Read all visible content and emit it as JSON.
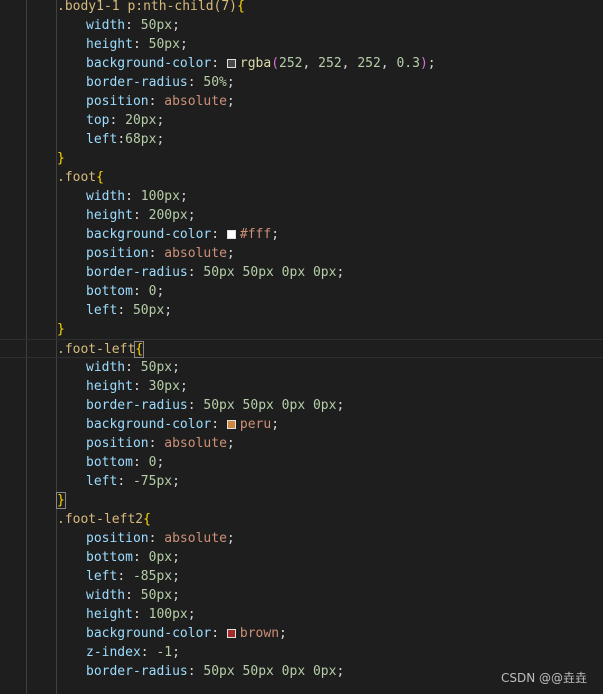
{
  "colors": {
    "background": "#1e1e1e",
    "selector": "#d7ba7d",
    "brace": "#ffd700",
    "property": "#9cdcfe",
    "number": "#b5cea8",
    "keyword": "#ce9178",
    "function": "#dcdcaa",
    "paren": "#da70d6"
  },
  "lines": [
    {
      "indent": 1,
      "tokens": [
        {
          "t": ".body1-1 p:nth-child(7)",
          "c": "sel"
        },
        {
          "t": "{",
          "c": "brace"
        }
      ]
    },
    {
      "indent": 2,
      "tokens": [
        {
          "t": "width",
          "c": "prop"
        },
        {
          "t": ": ",
          "c": "punct"
        },
        {
          "t": "50px",
          "c": "num"
        },
        {
          "t": ";",
          "c": "punct"
        }
      ]
    },
    {
      "indent": 2,
      "tokens": [
        {
          "t": "height",
          "c": "prop"
        },
        {
          "t": ": ",
          "c": "punct"
        },
        {
          "t": "50px",
          "c": "num"
        },
        {
          "t": ";",
          "c": "punct"
        }
      ]
    },
    {
      "indent": 2,
      "tokens": [
        {
          "t": "background-color",
          "c": "prop"
        },
        {
          "t": ": ",
          "c": "punct"
        },
        {
          "swatch": "#4a4a4a"
        },
        {
          "t": "rgba",
          "c": "fn"
        },
        {
          "t": "(",
          "c": "paren"
        },
        {
          "t": "252",
          "c": "num"
        },
        {
          "t": ", ",
          "c": "punct"
        },
        {
          "t": "252",
          "c": "num"
        },
        {
          "t": ", ",
          "c": "punct"
        },
        {
          "t": "252",
          "c": "num"
        },
        {
          "t": ", ",
          "c": "punct"
        },
        {
          "t": "0.3",
          "c": "num"
        },
        {
          "t": ")",
          "c": "paren"
        },
        {
          "t": ";",
          "c": "punct"
        }
      ]
    },
    {
      "indent": 2,
      "tokens": [
        {
          "t": "border-radius",
          "c": "prop"
        },
        {
          "t": ": ",
          "c": "punct"
        },
        {
          "t": "50%",
          "c": "num"
        },
        {
          "t": ";",
          "c": "punct"
        }
      ]
    },
    {
      "indent": 2,
      "tokens": [
        {
          "t": "position",
          "c": "prop"
        },
        {
          "t": ": ",
          "c": "punct"
        },
        {
          "t": "absolute",
          "c": "kw"
        },
        {
          "t": ";",
          "c": "punct"
        }
      ]
    },
    {
      "indent": 2,
      "tokens": [
        {
          "t": "top",
          "c": "prop"
        },
        {
          "t": ": ",
          "c": "punct"
        },
        {
          "t": "20px",
          "c": "num"
        },
        {
          "t": ";",
          "c": "punct"
        }
      ]
    },
    {
      "indent": 2,
      "tokens": [
        {
          "t": "left",
          "c": "prop"
        },
        {
          "t": ":",
          "c": "punct"
        },
        {
          "t": "68px",
          "c": "num"
        },
        {
          "t": ";",
          "c": "punct"
        }
      ]
    },
    {
      "indent": 1,
      "tokens": [
        {
          "t": "}",
          "c": "brace"
        }
      ]
    },
    {
      "indent": 1,
      "tokens": [
        {
          "t": ".foot",
          "c": "sel"
        },
        {
          "t": "{",
          "c": "brace"
        }
      ]
    },
    {
      "indent": 2,
      "tokens": [
        {
          "t": "width",
          "c": "prop"
        },
        {
          "t": ": ",
          "c": "punct"
        },
        {
          "t": "100px",
          "c": "num"
        },
        {
          "t": ";",
          "c": "punct"
        }
      ]
    },
    {
      "indent": 2,
      "tokens": [
        {
          "t": "height",
          "c": "prop"
        },
        {
          "t": ": ",
          "c": "punct"
        },
        {
          "t": "200px",
          "c": "num"
        },
        {
          "t": ";",
          "c": "punct"
        }
      ]
    },
    {
      "indent": 2,
      "tokens": [
        {
          "t": "background-color",
          "c": "prop"
        },
        {
          "t": ": ",
          "c": "punct"
        },
        {
          "swatch": "#ffffff"
        },
        {
          "t": "#fff",
          "c": "kw"
        },
        {
          "t": ";",
          "c": "punct"
        }
      ]
    },
    {
      "indent": 2,
      "tokens": [
        {
          "t": "position",
          "c": "prop"
        },
        {
          "t": ": ",
          "c": "punct"
        },
        {
          "t": "absolute",
          "c": "kw"
        },
        {
          "t": ";",
          "c": "punct"
        }
      ]
    },
    {
      "indent": 2,
      "tokens": [
        {
          "t": "border-radius",
          "c": "prop"
        },
        {
          "t": ": ",
          "c": "punct"
        },
        {
          "t": "50px 50px 0px 0px",
          "c": "num"
        },
        {
          "t": ";",
          "c": "punct"
        }
      ]
    },
    {
      "indent": 2,
      "tokens": [
        {
          "t": "bottom",
          "c": "prop"
        },
        {
          "t": ": ",
          "c": "punct"
        },
        {
          "t": "0",
          "c": "num"
        },
        {
          "t": ";",
          "c": "punct"
        }
      ]
    },
    {
      "indent": 2,
      "tokens": [
        {
          "t": "left",
          "c": "prop"
        },
        {
          "t": ": ",
          "c": "punct"
        },
        {
          "t": "50px",
          "c": "num"
        },
        {
          "t": ";",
          "c": "punct"
        }
      ]
    },
    {
      "indent": 1,
      "tokens": [
        {
          "t": "}",
          "c": "brace"
        }
      ]
    },
    {
      "indent": 1,
      "current": true,
      "tokens": [
        {
          "t": ".foot-left",
          "c": "sel"
        },
        {
          "t": "{",
          "c": "brace active"
        }
      ]
    },
    {
      "indent": 2,
      "tokens": [
        {
          "t": "width",
          "c": "prop"
        },
        {
          "t": ": ",
          "c": "punct"
        },
        {
          "t": "50px",
          "c": "num"
        },
        {
          "t": ";",
          "c": "punct"
        }
      ]
    },
    {
      "indent": 2,
      "tokens": [
        {
          "t": "height",
          "c": "prop"
        },
        {
          "t": ": ",
          "c": "punct"
        },
        {
          "t": "30px",
          "c": "num"
        },
        {
          "t": ";",
          "c": "punct"
        }
      ]
    },
    {
      "indent": 2,
      "tokens": [
        {
          "t": "border-radius",
          "c": "prop"
        },
        {
          "t": ": ",
          "c": "punct"
        },
        {
          "t": "50px 50px 0px 0px",
          "c": "num"
        },
        {
          "t": ";",
          "c": "punct"
        }
      ]
    },
    {
      "indent": 2,
      "tokens": [
        {
          "t": "background-color",
          "c": "prop"
        },
        {
          "t": ": ",
          "c": "punct"
        },
        {
          "swatch": "#cd853f"
        },
        {
          "t": "peru",
          "c": "kw"
        },
        {
          "t": ";",
          "c": "punct"
        }
      ]
    },
    {
      "indent": 2,
      "tokens": [
        {
          "t": "position",
          "c": "prop"
        },
        {
          "t": ": ",
          "c": "punct"
        },
        {
          "t": "absolute",
          "c": "kw"
        },
        {
          "t": ";",
          "c": "punct"
        }
      ]
    },
    {
      "indent": 2,
      "tokens": [
        {
          "t": "bottom",
          "c": "prop"
        },
        {
          "t": ": ",
          "c": "punct"
        },
        {
          "t": "0",
          "c": "num"
        },
        {
          "t": ";",
          "c": "punct"
        }
      ]
    },
    {
      "indent": 2,
      "tokens": [
        {
          "t": "left",
          "c": "prop"
        },
        {
          "t": ": ",
          "c": "punct"
        },
        {
          "t": "-75px",
          "c": "num"
        },
        {
          "t": ";",
          "c": "punct"
        }
      ]
    },
    {
      "indent": 1,
      "tokens": [
        {
          "t": "}",
          "c": "brace active"
        }
      ]
    },
    {
      "indent": 1,
      "tokens": [
        {
          "t": ".foot-left2",
          "c": "sel"
        },
        {
          "t": "{",
          "c": "brace"
        }
      ]
    },
    {
      "indent": 2,
      "tokens": [
        {
          "t": "position",
          "c": "prop"
        },
        {
          "t": ": ",
          "c": "punct"
        },
        {
          "t": "absolute",
          "c": "kw"
        },
        {
          "t": ";",
          "c": "punct"
        }
      ]
    },
    {
      "indent": 2,
      "tokens": [
        {
          "t": "bottom",
          "c": "prop"
        },
        {
          "t": ": ",
          "c": "punct"
        },
        {
          "t": "0px",
          "c": "num"
        },
        {
          "t": ";",
          "c": "punct"
        }
      ]
    },
    {
      "indent": 2,
      "tokens": [
        {
          "t": "left",
          "c": "prop"
        },
        {
          "t": ": ",
          "c": "punct"
        },
        {
          "t": "-85px",
          "c": "num"
        },
        {
          "t": ";",
          "c": "punct"
        }
      ]
    },
    {
      "indent": 2,
      "tokens": [
        {
          "t": "width",
          "c": "prop"
        },
        {
          "t": ": ",
          "c": "punct"
        },
        {
          "t": "50px",
          "c": "num"
        },
        {
          "t": ";",
          "c": "punct"
        }
      ]
    },
    {
      "indent": 2,
      "tokens": [
        {
          "t": "height",
          "c": "prop"
        },
        {
          "t": ": ",
          "c": "punct"
        },
        {
          "t": "100px",
          "c": "num"
        },
        {
          "t": ";",
          "c": "punct"
        }
      ]
    },
    {
      "indent": 2,
      "tokens": [
        {
          "t": "background-color",
          "c": "prop"
        },
        {
          "t": ": ",
          "c": "punct"
        },
        {
          "swatch": "#a52a2a"
        },
        {
          "t": "brown",
          "c": "kw"
        },
        {
          "t": ";",
          "c": "punct"
        }
      ]
    },
    {
      "indent": 2,
      "tokens": [
        {
          "t": "z-index",
          "c": "prop"
        },
        {
          "t": ": ",
          "c": "punct"
        },
        {
          "t": "-1",
          "c": "num"
        },
        {
          "t": ";",
          "c": "punct"
        }
      ]
    },
    {
      "indent": 2,
      "tokens": [
        {
          "t": "border-radius",
          "c": "prop"
        },
        {
          "t": ": ",
          "c": "punct"
        },
        {
          "t": "50px 50px 0px 0px",
          "c": "num"
        },
        {
          "t": ";",
          "c": "punct"
        }
      ]
    }
  ],
  "watermark": "CSDN @@垚垚"
}
